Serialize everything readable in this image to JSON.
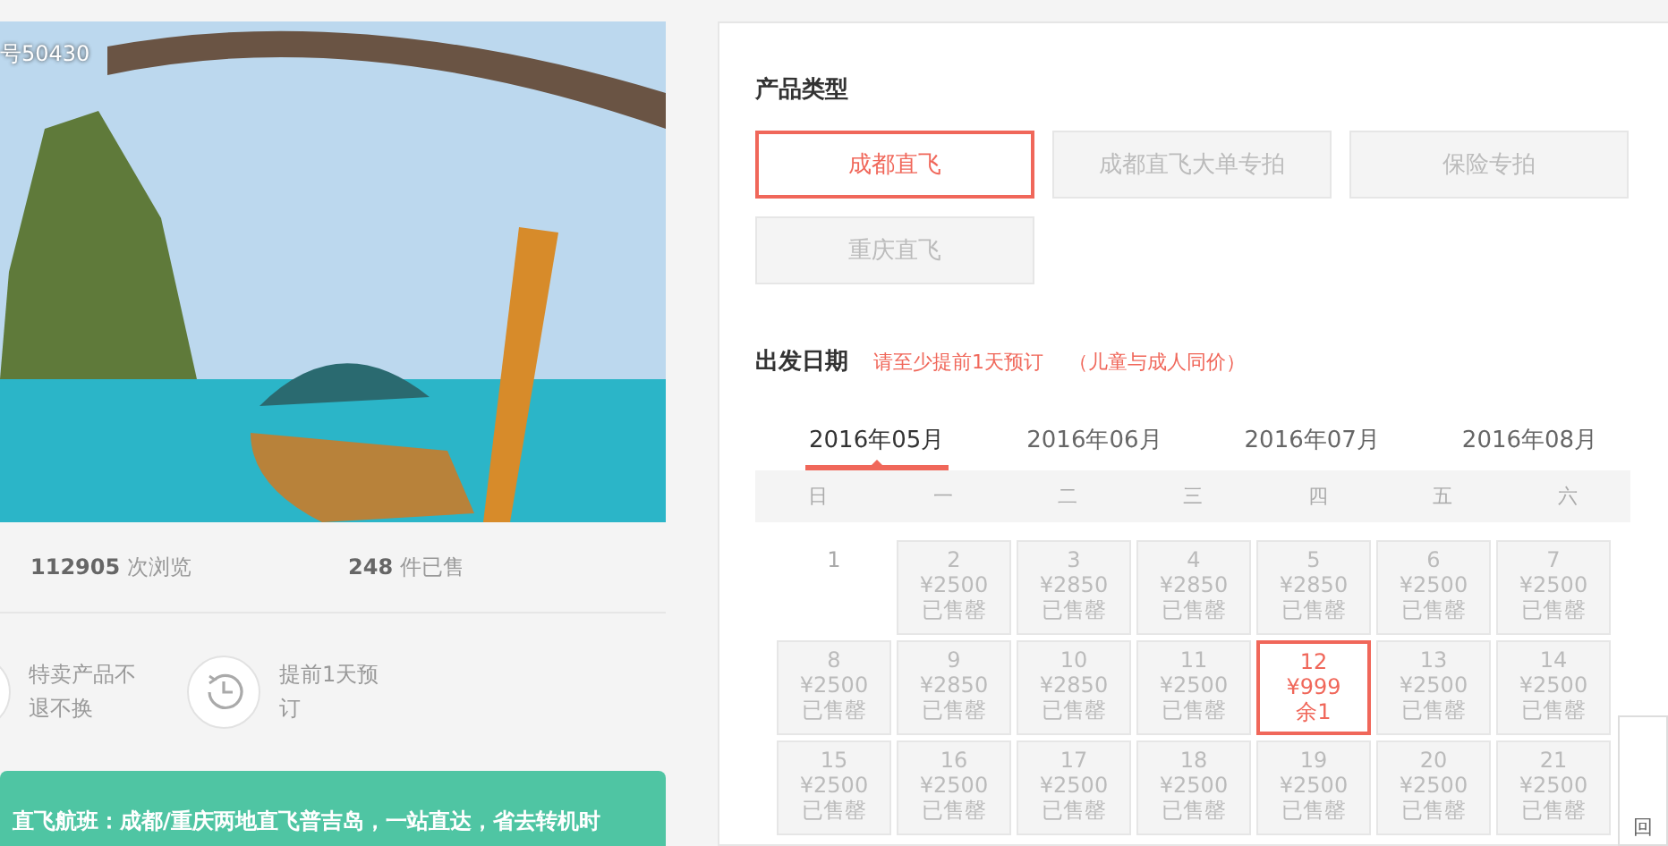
{
  "product": {
    "code_label": "号50430",
    "views": {
      "count": "112905",
      "label": "次浏览"
    },
    "sold": {
      "count": "248",
      "label": "件已售"
    },
    "features": [
      {
        "text": "特卖产品不退不换",
        "kind": "partial"
      },
      {
        "text": "提前1天预订",
        "kind": "clock"
      }
    ],
    "banner": "直飞航班：成都/重庆两地直飞普吉岛，一站直达，省去转机时"
  },
  "booking": {
    "type_title": "产品类型",
    "types": [
      {
        "label": "成都直飞",
        "selected": true
      },
      {
        "label": "成都直飞大单专拍",
        "selected": false
      },
      {
        "label": "保险专拍",
        "selected": false
      },
      {
        "label": "重庆直飞",
        "selected": false
      }
    ],
    "date_title": "出发日期",
    "notes": [
      "请至少提前1天预订",
      "（儿童与成人同价）"
    ],
    "months": [
      {
        "label": "2016年05月",
        "selected": true
      },
      {
        "label": "2016年06月",
        "selected": false
      },
      {
        "label": "2016年07月",
        "selected": false
      },
      {
        "label": "2016年08月",
        "selected": false
      }
    ],
    "weekdays": [
      "日",
      "一",
      "二",
      "三",
      "四",
      "五",
      "六"
    ],
    "days": [
      {
        "kind": "plain",
        "date": "1",
        "selected": false
      },
      {
        "kind": "priced",
        "date": "2",
        "price": "¥2500",
        "status": "已售罄",
        "selected": false
      },
      {
        "kind": "priced",
        "date": "3",
        "price": "¥2850",
        "status": "已售罄",
        "selected": false
      },
      {
        "kind": "priced",
        "date": "4",
        "price": "¥2850",
        "status": "已售罄",
        "selected": false
      },
      {
        "kind": "priced",
        "date": "5",
        "price": "¥2850",
        "status": "已售罄",
        "selected": false
      },
      {
        "kind": "priced",
        "date": "6",
        "price": "¥2500",
        "status": "已售罄",
        "selected": false
      },
      {
        "kind": "priced",
        "date": "7",
        "price": "¥2500",
        "status": "已售罄",
        "selected": false
      },
      {
        "kind": "priced",
        "date": "8",
        "price": "¥2500",
        "status": "已售罄",
        "selected": false
      },
      {
        "kind": "priced",
        "date": "9",
        "price": "¥2850",
        "status": "已售罄",
        "selected": false
      },
      {
        "kind": "priced",
        "date": "10",
        "price": "¥2850",
        "status": "已售罄",
        "selected": false
      },
      {
        "kind": "priced",
        "date": "11",
        "price": "¥2500",
        "status": "已售罄",
        "selected": false
      },
      {
        "kind": "priced",
        "date": "12",
        "price": "¥999",
        "status": "余1",
        "selected": true
      },
      {
        "kind": "priced",
        "date": "13",
        "price": "¥2500",
        "status": "已售罄",
        "selected": false
      },
      {
        "kind": "priced",
        "date": "14",
        "price": "¥2500",
        "status": "已售罄",
        "selected": false
      },
      {
        "kind": "priced",
        "date": "15",
        "price": "¥2500",
        "status": "已售罄",
        "selected": false
      },
      {
        "kind": "priced",
        "date": "16",
        "price": "¥2500",
        "status": "已售罄",
        "selected": false
      },
      {
        "kind": "priced",
        "date": "17",
        "price": "¥2500",
        "status": "已售罄",
        "selected": false
      },
      {
        "kind": "priced",
        "date": "18",
        "price": "¥2500",
        "status": "已售罄",
        "selected": false
      },
      {
        "kind": "priced",
        "date": "19",
        "price": "¥2500",
        "status": "已售罄",
        "selected": false
      },
      {
        "kind": "priced",
        "date": "20",
        "price": "¥2500",
        "status": "已售罄",
        "selected": false
      },
      {
        "kind": "priced",
        "date": "21",
        "price": "¥2500",
        "status": "已售罄",
        "selected": false
      }
    ]
  },
  "back_to_top": "回"
}
